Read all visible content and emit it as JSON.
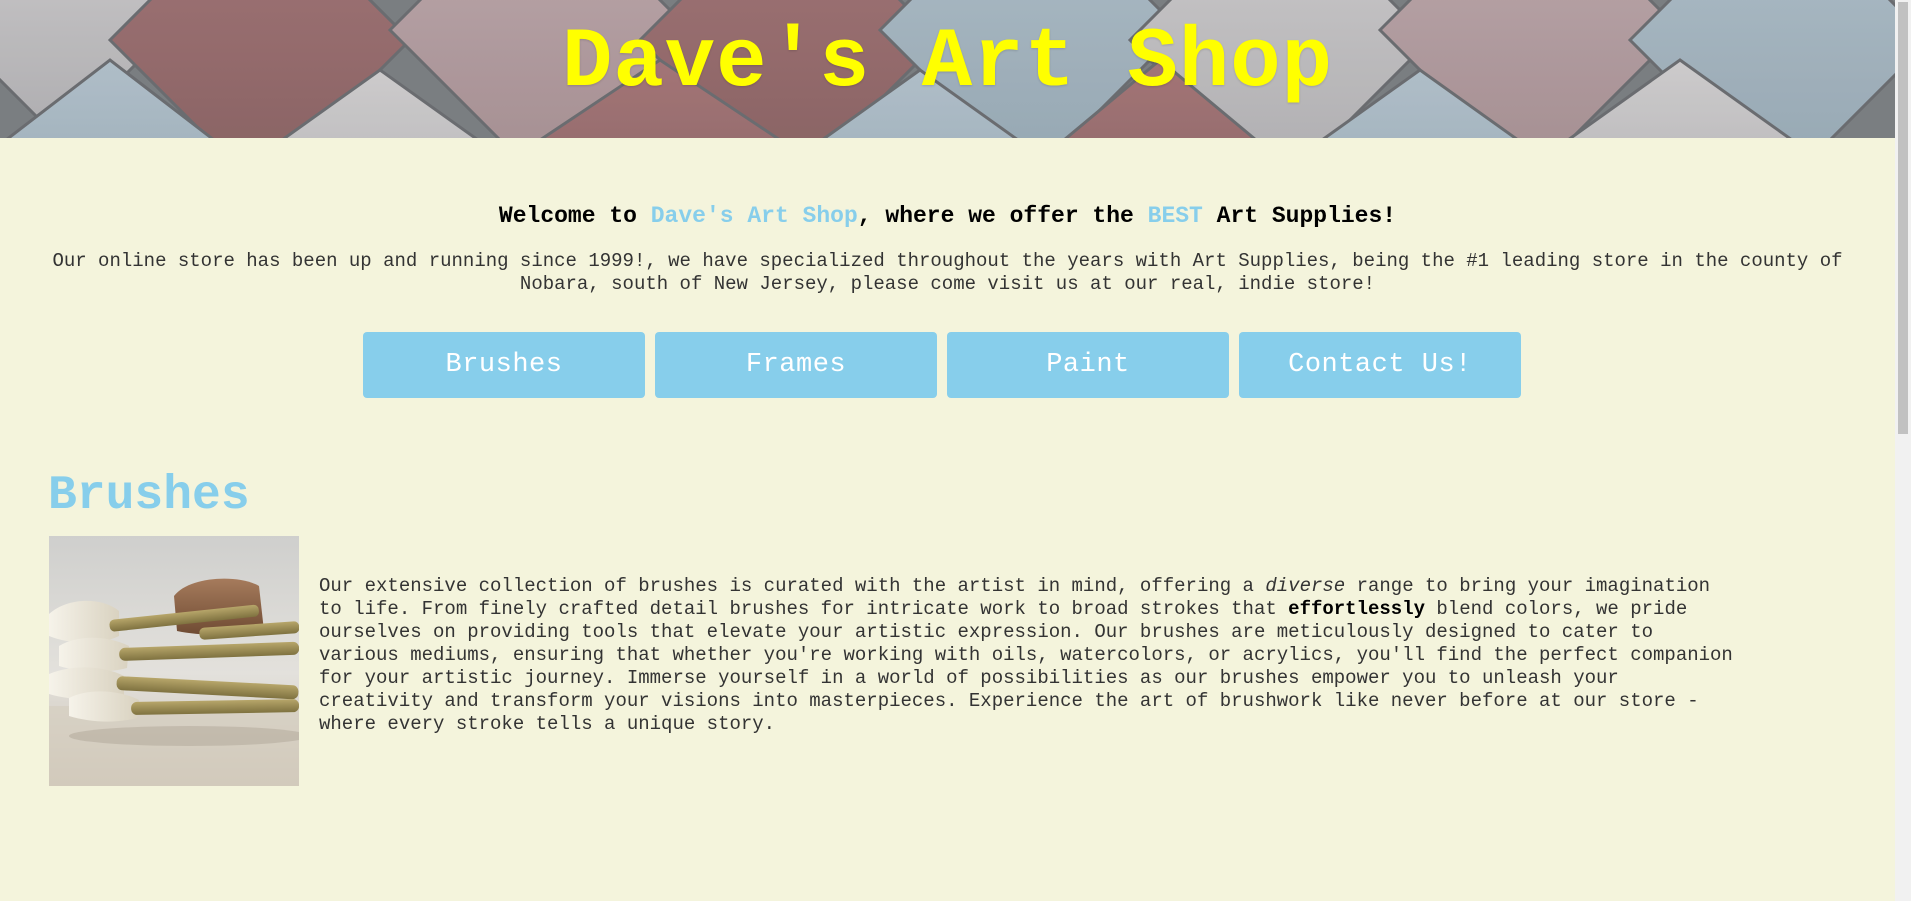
{
  "header": {
    "title": "Dave's Art Shop"
  },
  "welcome": {
    "part1": "Welcome to ",
    "shop_name": "Dave's Art Shop",
    "part2": ", where we offer the ",
    "best": "BEST",
    "part3": " Art Supplies!"
  },
  "intro": {
    "text": "Our online store has been up and running since 1999!, we have specialized throughout the years with Art Supplies, being the #1 leading store in the county of Nobara, south of New Jersey, please come visit us at our real, indie store!"
  },
  "nav": {
    "items": [
      {
        "label": "Brushes"
      },
      {
        "label": "Frames"
      },
      {
        "label": "Paint"
      },
      {
        "label": "Contact Us!"
      }
    ]
  },
  "brushes": {
    "title": "Brushes",
    "image_icon": "paintbrushes-photo",
    "text_part1": "Our extensive collection of brushes is curated with the artist in mind, offering a ",
    "text_em": "diverse",
    "text_part2": " range to bring your imagination to life. From finely crafted detail brushes for intricate work to broad strokes that ",
    "text_strong": "effortlessly",
    "text_part3": " blend colors, we pride ourselves on providing tools that elevate your artistic expression. Our brushes are meticulously designed to cater to various mediums, ensuring that whether you're working with oils, watercolors, or acrylics, you'll find the perfect companion for your artistic journey. Immerse yourself in a world of possibilities as our brushes empower you to unleash your creativity and transform your visions into masterpieces. Experience the art of brushwork like never before at our store - where every stroke tells a unique story."
  },
  "colors": {
    "background": "#f4f4dc",
    "accent": "#87ceeb",
    "title": "#ffff00"
  }
}
